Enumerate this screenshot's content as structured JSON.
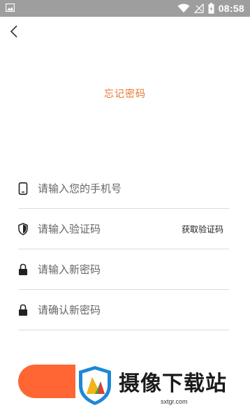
{
  "status_bar": {
    "time": "08:58",
    "icons": [
      "gallery-icon",
      "wifi-icon",
      "signal-icon",
      "battery-icon"
    ]
  },
  "header": {
    "back_icon": "chevron-left-icon",
    "title": "忘记密码"
  },
  "form": {
    "phone_placeholder": "请输入您的手机号",
    "code_placeholder": "请输入验证码",
    "get_code_label": "获取验证码",
    "new_password_placeholder": "请输入新密码",
    "confirm_password_placeholder": "请确认新密码"
  },
  "watermark": {
    "text": "摄像下载站",
    "url": "sxtgr.com"
  },
  "colors": {
    "accent": "#e8762d",
    "button": "#ff6633",
    "status_bar": "#9e9e9e",
    "divider": "#dcdcdc"
  }
}
